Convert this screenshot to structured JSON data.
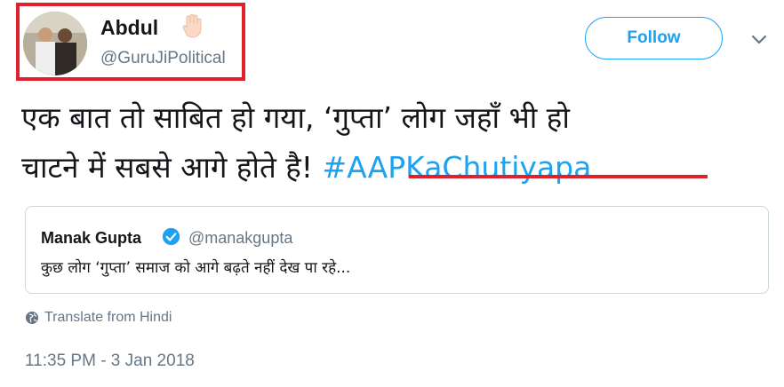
{
  "author": {
    "name": "Abdul",
    "handle": "@GuruJiPolitical"
  },
  "follow_button": {
    "label": "Follow"
  },
  "tweet": {
    "text_line1": "एक बात तो साबित हो गया, ‘गुप्ता’ लोग जहाँ भी हो",
    "text_line2": "चाटने में सबसे आगे होते है! ",
    "hashtag": "#AAPKaChutiyapa"
  },
  "quoted_tweet": {
    "name": "Manak Gupta",
    "handle": "@manakgupta",
    "text": "कुछ लोग ‘गुप्ता’ समाज को आगे बढ़ते नहीं देख पा रहे..."
  },
  "translate_label": "Translate from Hindi",
  "timestamp": "11:35 PM - 3 Jan 2018",
  "colors": {
    "accent": "#1da1f2",
    "highlight_annotation": "#e0202b",
    "secondary_text": "#657786"
  },
  "icons": [
    "raised-hand-icon",
    "chevron-down-icon",
    "verified-badge-icon",
    "globe-icon"
  ]
}
